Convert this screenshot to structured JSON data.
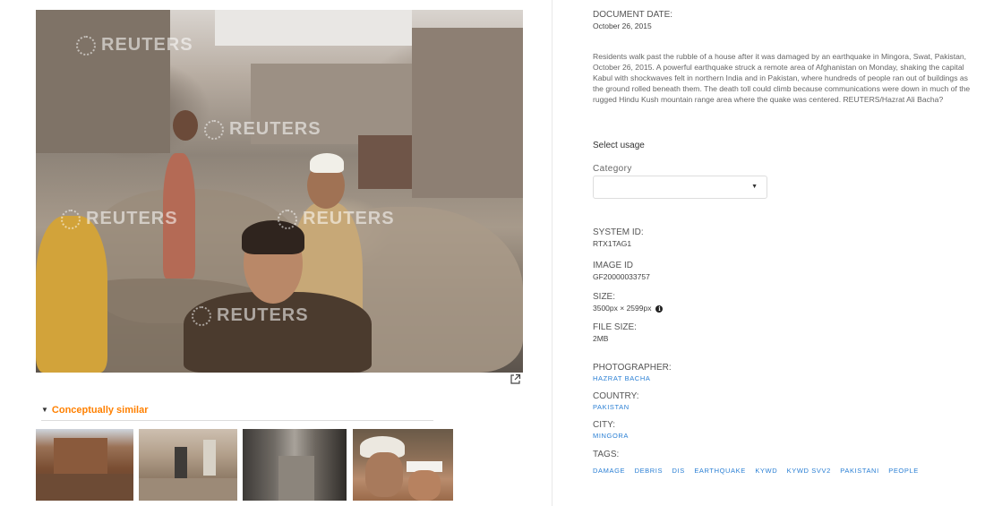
{
  "image": {
    "watermark_text": "REUTERS"
  },
  "similar": {
    "label": "Conceptually similar"
  },
  "metadata": {
    "document_date_label": "DOCUMENT DATE:",
    "document_date": "October 26, 2015",
    "caption": "Residents walk past the rubble of a house after it was damaged by an earthquake in Mingora, Swat, Pakistan, October 26, 2015. A powerful earthquake struck a remote area of Afghanistan on Monday, shaking the capital Kabul with shockwaves felt in northern India and in Pakistan, where hundreds of people ran out of buildings as the ground rolled beneath them. The death toll could climb because communications were down in much of the rugged Hindu Kush mountain range area where the quake was centered. REUTERS/Hazrat Ali Bacha?",
    "select_usage_label": "Select usage",
    "category_label": "Category",
    "category_value": "",
    "system_id_label": "SYSTEM ID:",
    "system_id": "RTX1TAG1",
    "image_id_label": "IMAGE ID",
    "image_id": "GF20000033757",
    "size_label": "SIZE:",
    "size": "3500px × 2599px",
    "file_size_label": "FILE SIZE:",
    "file_size": "2MB",
    "photographer_label": "PHOTOGRAPHER:",
    "photographer": "HAZRAT BACHA",
    "country_label": "COUNTRY:",
    "country": "PAKISTAN",
    "city_label": "CITY:",
    "city": "MINGORA",
    "tags_label": "TAGS:",
    "tags": [
      "DAMAGE",
      "DEBRIS",
      "DIS",
      "EARTHQUAKE",
      "KYWD",
      "KYWD SVV2",
      "PAKISTANI",
      "PEOPLE"
    ]
  },
  "icons": {
    "external_link": "external-link-icon",
    "info": "info-icon",
    "caret_down": "chevron-down-icon"
  }
}
